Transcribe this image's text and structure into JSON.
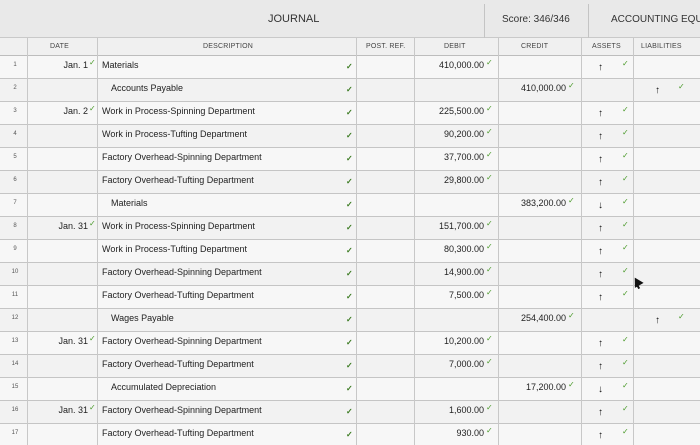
{
  "header": {
    "journal_title": "JOURNAL",
    "score": "Score: 346/346",
    "accounting_equation": "ACCOUNTING EQUAT"
  },
  "columns": {
    "date": "DATE",
    "description": "DESCRIPTION",
    "post_ref": "POST. REF.",
    "debit": "DEBIT",
    "credit": "CREDIT",
    "assets": "ASSETS",
    "liabilities": "LIABILITIES"
  },
  "rows": [
    {
      "num": "1",
      "date": "Jan. 1",
      "description": "Materials",
      "indent": false,
      "debit": "410,000.00",
      "credit": "",
      "assets": "↑",
      "liabilities": ""
    },
    {
      "num": "2",
      "date": "",
      "description": "Accounts Payable",
      "indent": true,
      "debit": "",
      "credit": "410,000.00",
      "assets": "",
      "liabilities": "↑"
    },
    {
      "num": "3",
      "date": "Jan. 2",
      "description": "Work in Process-Spinning Department",
      "indent": false,
      "debit": "225,500.00",
      "credit": "",
      "assets": "↑",
      "liabilities": ""
    },
    {
      "num": "4",
      "date": "",
      "description": "Work in Process-Tufting Department",
      "indent": false,
      "debit": "90,200.00",
      "credit": "",
      "assets": "↑",
      "liabilities": ""
    },
    {
      "num": "5",
      "date": "",
      "description": "Factory Overhead-Spinning Department",
      "indent": false,
      "debit": "37,700.00",
      "credit": "",
      "assets": "↑",
      "liabilities": ""
    },
    {
      "num": "6",
      "date": "",
      "description": "Factory Overhead-Tufting Department",
      "indent": false,
      "debit": "29,800.00",
      "credit": "",
      "assets": "↑",
      "liabilities": ""
    },
    {
      "num": "7",
      "date": "",
      "description": "Materials",
      "indent": true,
      "debit": "",
      "credit": "383,200.00",
      "assets": "↓",
      "liabilities": ""
    },
    {
      "num": "8",
      "date": "Jan. 31",
      "description": "Work in Process-Spinning Department",
      "indent": false,
      "debit": "151,700.00",
      "credit": "",
      "assets": "↑",
      "liabilities": ""
    },
    {
      "num": "9",
      "date": "",
      "description": "Work in Process-Tufting Department",
      "indent": false,
      "debit": "80,300.00",
      "credit": "",
      "assets": "↑",
      "liabilities": ""
    },
    {
      "num": "10",
      "date": "",
      "description": "Factory Overhead-Spinning Department",
      "indent": false,
      "debit": "14,900.00",
      "credit": "",
      "assets": "↑",
      "liabilities": ""
    },
    {
      "num": "11",
      "date": "",
      "description": "Factory Overhead-Tufting Department",
      "indent": false,
      "debit": "7,500.00",
      "credit": "",
      "assets": "↑",
      "liabilities": ""
    },
    {
      "num": "12",
      "date": "",
      "description": "Wages Payable",
      "indent": true,
      "debit": "",
      "credit": "254,400.00",
      "assets": "",
      "liabilities": "↑"
    },
    {
      "num": "13",
      "date": "Jan. 31",
      "description": "Factory Overhead-Spinning Department",
      "indent": false,
      "debit": "10,200.00",
      "credit": "",
      "assets": "↑",
      "liabilities": ""
    },
    {
      "num": "14",
      "date": "",
      "description": "Factory Overhead-Tufting Department",
      "indent": false,
      "debit": "7,000.00",
      "credit": "",
      "assets": "↑",
      "liabilities": ""
    },
    {
      "num": "15",
      "date": "",
      "description": "Accumulated Depreciation",
      "indent": true,
      "debit": "",
      "credit": "17,200.00",
      "assets": "↓",
      "liabilities": ""
    },
    {
      "num": "16",
      "date": "Jan. 31",
      "description": "Factory Overhead-Spinning Department",
      "indent": false,
      "debit": "1,600.00",
      "credit": "",
      "assets": "↑",
      "liabilities": ""
    },
    {
      "num": "17",
      "date": "",
      "description": "Factory Overhead-Tufting Department",
      "indent": false,
      "debit": "930.00",
      "credit": "",
      "assets": "↑",
      "liabilities": ""
    }
  ],
  "colors": {
    "check": "#4a9a2a",
    "grid": "#c8c8c8",
    "background": "#ebebeb"
  },
  "icons": {
    "check": "checkmark-icon",
    "increase": "arrow-up-icon",
    "decrease": "arrow-down-icon",
    "pointer": "mouse-cursor-icon"
  }
}
